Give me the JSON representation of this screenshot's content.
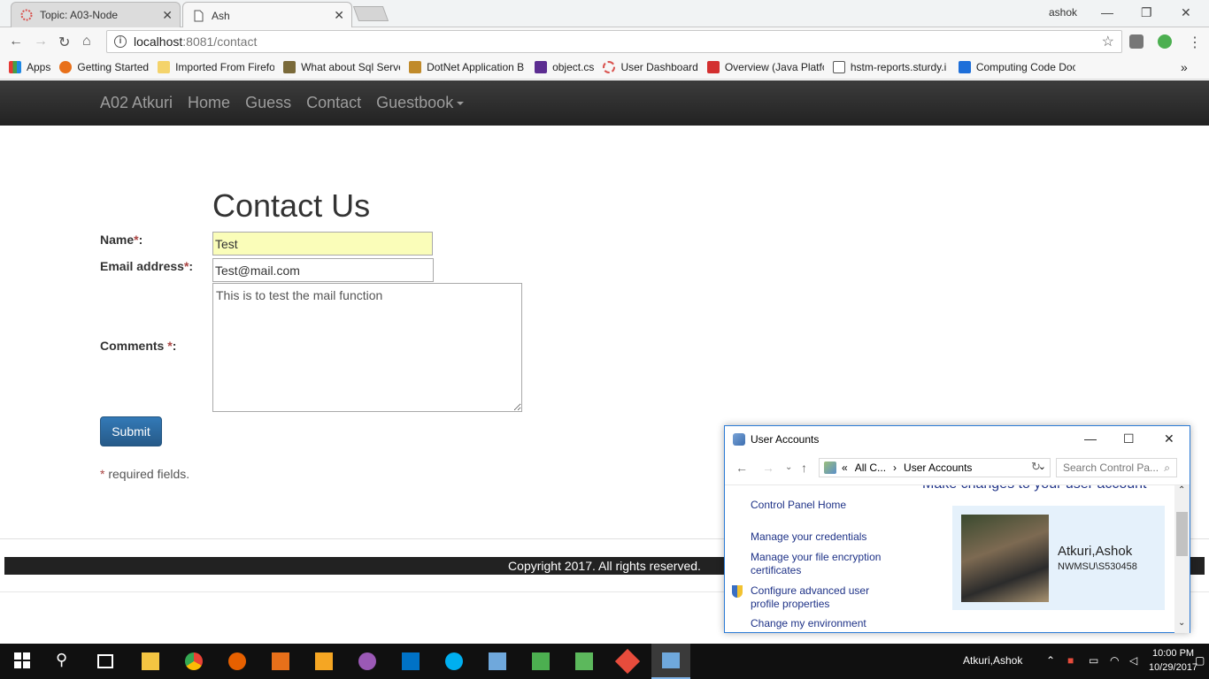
{
  "browser": {
    "tabs": [
      {
        "title": "Topic: A03-Node",
        "active": false
      },
      {
        "title": "Ash",
        "active": true
      }
    ],
    "profile_name": "ashok",
    "address": {
      "host": "localhost",
      "path": ":8081/contact"
    },
    "bookmarks": [
      "Apps",
      "Getting Started",
      "Imported From Firefo",
      "What about Sql Serve",
      "DotNet Application B",
      "object.cs",
      "User Dashboard",
      "Overview (Java Platfo",
      "hstm-reports.sturdy.i",
      "Computing Code Doc"
    ],
    "overflow_glyph": "»"
  },
  "site_nav": {
    "brand": "A02 Atkuri",
    "links": [
      "Home",
      "Guess",
      "Contact",
      "Guestbook"
    ]
  },
  "form": {
    "heading": "Contact Us",
    "name_label": "Name",
    "name_value": "Test",
    "email_label": "Email address",
    "email_value": "Test@mail.com",
    "comments_label": "Comments ",
    "comments_value": "This is to test the mail function",
    "required_star": "*",
    "colon": ":",
    "submit_label": "Submit",
    "required_note": " required fields."
  },
  "footer": {
    "text": "Copyright 2017. All rights reserved."
  },
  "user_accounts_dialog": {
    "title": "User Accounts",
    "path_prefix": "«",
    "path_parent": "All C...",
    "path_sep": "›",
    "path_current": "User Accounts",
    "search_placeholder": "Search Control Pa...",
    "heading": "Make changes to your user account",
    "links": [
      "Control Panel Home",
      "Manage your credentials",
      "Manage your file encryption certificates",
      "Configure advanced user profile properties",
      "Change my environment"
    ],
    "user_name": "Atkuri,Ashok",
    "user_account": "NWMSU\\S530458"
  },
  "taskbar": {
    "user": "Atkuri,Ashok",
    "time": "10:00 PM",
    "date": "10/29/2017"
  },
  "colors": {
    "navbar": "#222222",
    "primary_button": "#337ab7",
    "required": "#a94442",
    "name_input_bg": "#fafdb9",
    "dialog_border": "#2b7bd6"
  }
}
